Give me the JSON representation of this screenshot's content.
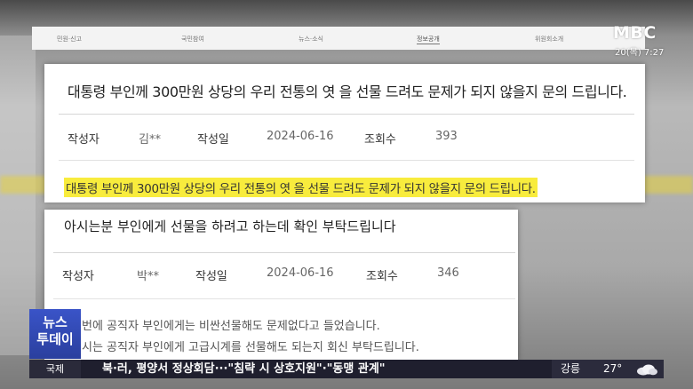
{
  "broadcaster": {
    "logo": "MBC",
    "clock": "20(목) 7:27"
  },
  "nav": {
    "items": [
      "민원·신고",
      "국민참여",
      "뉴스·소식",
      "정보공개",
      "위원회소개"
    ],
    "active_index": 3
  },
  "post1": {
    "title": "대통령 부인께 300만원 상당의 우리 전통의 엿 을 선물 드려도 문제가 되지 않을지 문의 드립니다.",
    "author_label": "작성자",
    "author": "김**",
    "date_label": "작성일",
    "date": "2024-06-16",
    "views_label": "조회수",
    "views": "393",
    "body": "대통령 부인께 300만원 상당의 우리 전통의 엿 을 선물 드려도 문제가 되지 않을지 문의 드립니다.",
    "highlight_color": "#f8ec3d"
  },
  "post2": {
    "title": "아시는분 부인에게 선물을 하려고 하는데 확인 부탁드립니다",
    "author_label": "작성자",
    "author": "박**",
    "date_label": "작성일",
    "date": "2024-06-16",
    "views_label": "조회수",
    "views": "346",
    "body_lines": [
      "번에 공직자 부인에게는 비싼선물해도 문제없다고 들었습니다.",
      "시는 공직자 부인에게 고급시계를 선물해도 되는지 회신 부탁드립니다."
    ]
  },
  "badge": {
    "line1": "뉴스",
    "line2": "투데이",
    "color": "#3a54c8"
  },
  "ticker": {
    "category": "국제",
    "headline": "북·러, 평양서 정상회담···\"침략 시 상호지원\"·\"동맹 관계\"",
    "city": "강릉",
    "temperature": "27°",
    "weather_icon": "cloud-icon"
  }
}
